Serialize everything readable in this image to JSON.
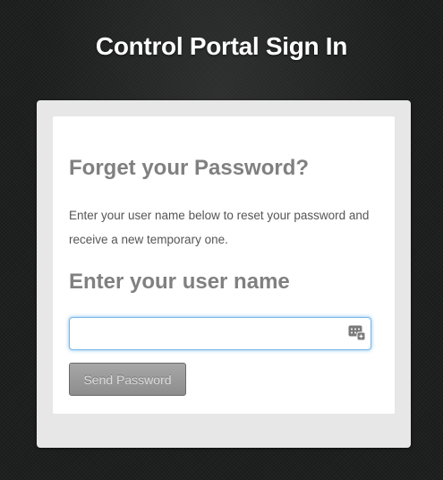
{
  "header": {
    "title": "Control Portal Sign In"
  },
  "form": {
    "heading": "Forget your Password?",
    "instructions": "Enter your user name below to reset your password and receive a new temporary one.",
    "username_heading": "Enter your user name",
    "username_value": "",
    "username_icon": "keychain-autofill-icon",
    "submit_label": "Send Password"
  },
  "colors": {
    "background": "#1e1f1f",
    "panel": "#e7e7e7",
    "card": "#ffffff",
    "heading_text": "#808080",
    "input_focus": "#7ab6e6",
    "button": "#999999"
  }
}
